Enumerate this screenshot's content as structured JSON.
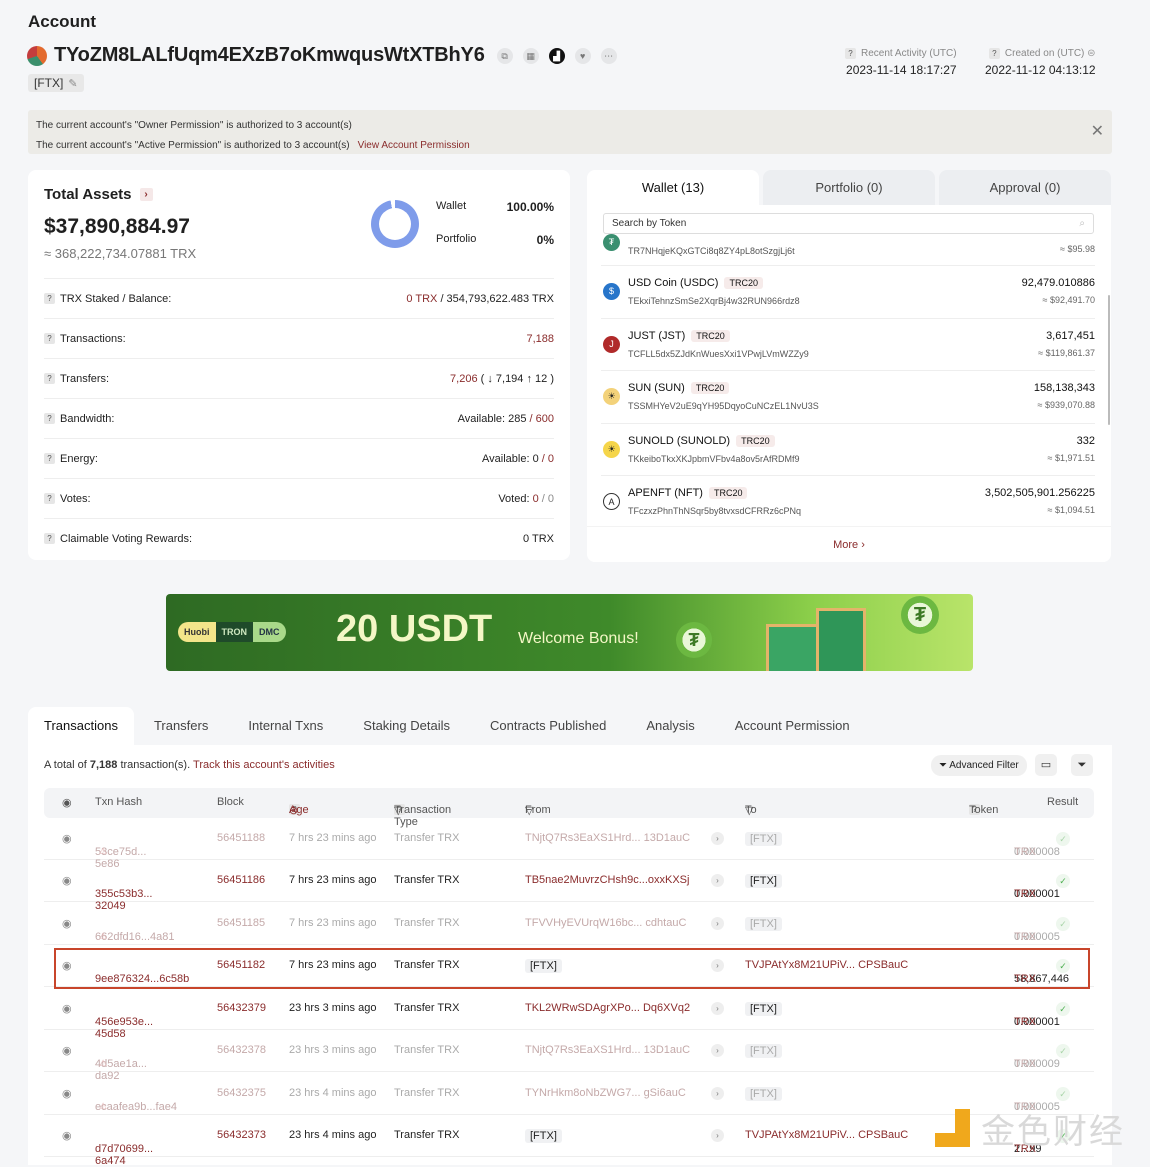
{
  "header": {
    "title": "Account",
    "address": "TYoZM8LALfUqm4EXzB7oKmwqusWtXTBhY6",
    "tag": "[FTX]",
    "address_icons": [
      "copy-icon",
      "qr-code-icon",
      "analytics-icon",
      "favorite-icon",
      "more-icon"
    ],
    "recent_activity_label": "Recent Activity (UTC)",
    "recent_activity_value": "2023-11-14 18:17:27",
    "created_label": "Created on (UTC)",
    "created_value": "2022-11-12 04:13:12"
  },
  "permission_banner": {
    "owner_text": "The current account's \"Owner Permission\" is authorized to 3 account(s)",
    "active_text": "The current account's \"Active Permission\" is authorized to 3 account(s)",
    "link": "View Account Permission"
  },
  "assets": {
    "title": "Total Assets",
    "usd": "$37,890,884.97",
    "trx": "≈ 368,222,734.07881 TRX",
    "legend": [
      {
        "label": "Wallet",
        "pct": "100.00%",
        "fraction": 1.0
      },
      {
        "label": "Portfolio",
        "pct": "0%",
        "fraction": 0.0
      }
    ],
    "stats": [
      {
        "label": "TRX Staked / Balance:",
        "value_a": "0 TRX",
        "value_b": " / 354,793,622.483 TRX"
      },
      {
        "label": "Transactions:",
        "value_a": "7,188",
        "value_b": ""
      },
      {
        "label": "Transfers:",
        "value_a": "7,206",
        "value_b": " ( ↓ 7,194 ↑ 12 )"
      },
      {
        "label": "Bandwidth:",
        "value_prefix": "Available: 285",
        "value_a": " / 600"
      },
      {
        "label": "Energy:",
        "value_prefix": "Available: 0",
        "value_a": " / 0"
      },
      {
        "label": "Votes:",
        "value_prefix": "Voted: ",
        "value_a": "0",
        "value_b": " / 0"
      },
      {
        "label": "Claimable Voting Rewards:",
        "value_prefix": "0 TRX"
      }
    ]
  },
  "wallet": {
    "tabs": [
      "Wallet (13)",
      "Portfolio (0)",
      "Approval (0)"
    ],
    "search_placeholder": "Search by Token",
    "tokens": [
      {
        "name": "",
        "badge": "",
        "address": "TR7NHqjeKQxGTCi8q8ZY4pL8otSzgjLj6t",
        "amount": "",
        "usd": "≈ $95.98"
      },
      {
        "name": "USD Coin (USDC)",
        "badge": "TRC20",
        "address": "TEkxiTehnzSmSe2XqrBj4w32RUN966rdz8",
        "amount": "92,479.010886",
        "usd": "≈ $92,491.70"
      },
      {
        "name": "JUST (JST)",
        "badge": "TRC20",
        "address": "TCFLL5dx5ZJdKnWuesXxi1VPwjLVmWZZy9",
        "amount": "3,617,451",
        "usd": "≈ $119,861.37"
      },
      {
        "name": "SUN (SUN)",
        "badge": "TRC20",
        "address": "TSSMHYeV2uE9qYH95DqyoCuNCzEL1NvU3S",
        "amount": "158,138,343",
        "usd": "≈ $939,070.88"
      },
      {
        "name": "SUNOLD (SUNOLD)",
        "badge": "TRC20",
        "address": "TKkeiboTkxXKJpbmVFbv4a8ov5rAfRDMf9",
        "amount": "332",
        "usd": "≈ $1,971.51"
      },
      {
        "name": "APENFT (NFT)",
        "badge": "TRC20",
        "address": "TFczxzPhnThNSqr5by8tvxsdCFRRz6cPNq",
        "amount": "3,502,505,901.256225",
        "usd": "≈ $1,094.51"
      }
    ],
    "more": "More ›"
  },
  "ad": {
    "logos": [
      "Huobi",
      "TRON",
      "DMC"
    ],
    "headline": "20 USDT",
    "subline": "Welcome Bonus!"
  },
  "transactions": {
    "tabs": [
      "Transactions",
      "Transfers",
      "Internal Txns",
      "Staking Details",
      "Contracts Published",
      "Analysis",
      "Account Permission"
    ],
    "summary_prefix": "A total of ",
    "summary_count": "7,188",
    "summary_suffix": " transaction(s). ",
    "track_link": "Track this account's activities",
    "advanced_filter": "Advanced Filter",
    "columns": [
      "Txn Hash",
      "Block",
      "Age",
      "Transaction Type",
      "From",
      "To",
      "Token",
      "Result"
    ],
    "rows": [
      {
        "hash": "53ce75d... 5e86",
        "block": "56451188",
        "age": "7 hrs 23 mins ago",
        "type": "Transfer TRX",
        "from": "TNjtQ7Rs3EaXS1Hrd... 13D1auC",
        "to": "[FTX]",
        "amount": "0.000008",
        "unit": "TRX",
        "faded": true,
        "warn": true
      },
      {
        "hash": "355c53b3... 32049",
        "block": "56451186",
        "age": "7 hrs 23 mins ago",
        "type": "Transfer TRX",
        "from": "TB5nae2MuvrzCHsh9c...oxxKXSj",
        "to": "[FTX]",
        "amount": "0.000001",
        "unit": "TRX",
        "faded": false,
        "warn": false
      },
      {
        "hash": "662dfd16...4a81",
        "block": "56451185",
        "age": "7 hrs 23 mins ago",
        "type": "Transfer TRX",
        "from": "TFVVHyEVUrqW16bc... cdhtauC",
        "to": "[FTX]",
        "amount": "0.000005",
        "unit": "TRX",
        "faded": true,
        "warn": true
      },
      {
        "hash": "9ee876324...6c58b",
        "block": "56451182",
        "age": "7 hrs 23 mins ago",
        "type": "Transfer TRX",
        "from": "[FTX]",
        "to": "TVJPAtYx8M21UPiV... CPSBauC",
        "amount": "58,867,446",
        "unit": "TRX",
        "faded": false,
        "warn": false,
        "highlighted": true
      },
      {
        "hash": "456e953e... 45d58",
        "block": "56432379",
        "age": "23 hrs 3 mins ago",
        "type": "Transfer TRX",
        "from": "TKL2WRwSDAgrXPo... Dq6XVq2",
        "to": "[FTX]",
        "amount": "0.000001",
        "unit": "TRX",
        "faded": false,
        "warn": false
      },
      {
        "hash": "4d5ae1a... da92",
        "block": "56432378",
        "age": "23 hrs 3 mins ago",
        "type": "Transfer TRX",
        "from": "TNjtQ7Rs3EaXS1Hrd... 13D1auC",
        "to": "[FTX]",
        "amount": "0.000009",
        "unit": "TRX",
        "faded": true,
        "warn": true
      },
      {
        "hash": "ecaafea9b...fae4",
        "block": "56432375",
        "age": "23 hrs 4 mins ago",
        "type": "Transfer TRX",
        "from": "TYNrHkm8oNbZWG7... gSi6auC",
        "to": "[FTX]",
        "amount": "0.000005",
        "unit": "TRX",
        "faded": true,
        "warn": true
      },
      {
        "hash": "d7d70699... 6a474",
        "block": "56432373",
        "age": "23 hrs 4 mins ago",
        "type": "Transfer TRX",
        "from": "[FTX]",
        "to": "TVJPAtYx8M21UPiV... CPSBauC",
        "amount": "2...99",
        "unit": "TRX",
        "faded": false,
        "warn": false
      }
    ]
  },
  "watermark": {
    "text": "金色财经"
  }
}
